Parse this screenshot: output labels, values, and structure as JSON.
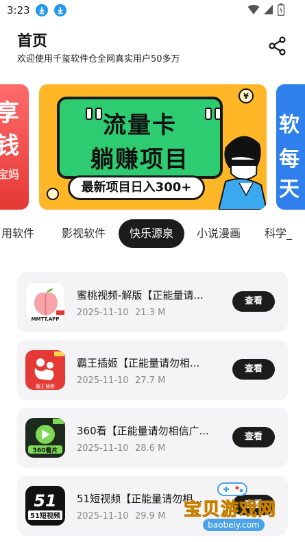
{
  "status_bar": {
    "time": "3:23"
  },
  "header": {
    "title": "首页",
    "subtitle": "欢迎使用千玺软件仓全网真实用户50多万"
  },
  "banner": {
    "main_line1": "流量卡",
    "main_line2": "躺赚项目",
    "main_pill": "最新项目日入300+",
    "left_partial_line1": "享",
    "left_partial_line2": "钱",
    "left_partial_line3": "宝妈",
    "right_partial_line1": "软",
    "right_partial_line2": "每天"
  },
  "tabs": {
    "items": [
      {
        "label": "用软件"
      },
      {
        "label": "影视软件"
      },
      {
        "label": "快乐源泉"
      },
      {
        "label": "小说漫画"
      },
      {
        "label": "科学_"
      }
    ],
    "active_index": 2
  },
  "apps": [
    {
      "name": "蜜桃视频-解版【正能量请...",
      "date": "2025-11-10",
      "size": "21.3 M",
      "button": "查看",
      "icon": "peach-app-icon",
      "icon_text": "MMTT.APP"
    },
    {
      "name": "霸王插姬【正能量请勿相...",
      "date": "2025-11-10",
      "size": "27.7 M",
      "button": "查看",
      "icon": "bawang-app-icon",
      "icon_text": "霸王插姬"
    },
    {
      "name": "360看【正能量请勿相信广...",
      "date": "2025-11-10",
      "size": "28.6 M",
      "button": "查看",
      "icon": "360-app-icon",
      "icon_text": "360看片"
    },
    {
      "name": "51短视频【正能量请勿相...",
      "date": "2025-11-10",
      "size": "29.9 M",
      "button": "查看",
      "icon": "51-app-icon",
      "icon_text": "51短视频"
    }
  ],
  "watermark": {
    "text": "宝贝游戏网",
    "url": "baobeiy.com"
  },
  "colors": {
    "accent_dark": "#1c1c1c",
    "banner_orange": "#ffb627",
    "banner_green": "#2ecc71",
    "card_bg": "#f4f4f6",
    "download_blue": "#2196f3"
  }
}
